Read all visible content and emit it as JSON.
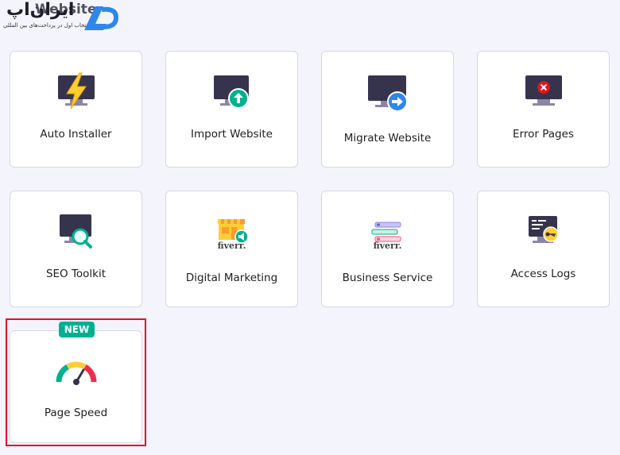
{
  "watermark": {
    "brand_fa": "ایران‌اپ",
    "brand_en": "Website",
    "tagline": "انتخاب اول در پرداخت‌های بین المللی"
  },
  "tools": [
    {
      "label": "Auto Installer",
      "icon": "lightning-monitor-icon"
    },
    {
      "label": "Import Website",
      "icon": "upload-monitor-icon"
    },
    {
      "label": "Migrate Website",
      "icon": "migrate-monitor-icon"
    },
    {
      "label": "Error Pages",
      "icon": "error-monitor-icon"
    },
    {
      "label": "SEO Toolkit",
      "icon": "search-monitor-icon"
    },
    {
      "label": "Digital Marketing",
      "icon": "fiverr-store-icon",
      "sub_logo": "fiverr."
    },
    {
      "label": "Business Service",
      "icon": "fiverr-list-icon",
      "sub_logo": "fiverr."
    },
    {
      "label": "Access Logs",
      "icon": "key-monitor-icon"
    },
    {
      "label": "Page Speed",
      "icon": "speedometer-icon",
      "badge": "NEW"
    }
  ],
  "colors": {
    "background": "#f4f4fc",
    "card_border": "#d7d7e6",
    "badge": "#00b090",
    "highlight": "#e3121f",
    "monitor": "#36344d",
    "accent_green": "#00b090",
    "accent_blue": "#2f86eb",
    "accent_red": "#fc5185",
    "accent_yellow": "#ffcd35"
  }
}
